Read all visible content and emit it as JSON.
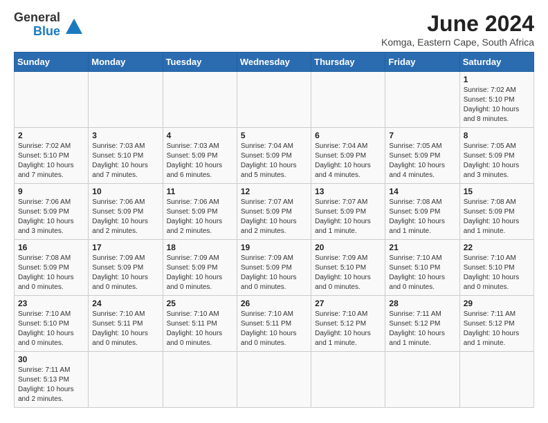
{
  "header": {
    "logo_line1": "General",
    "logo_line2": "Blue",
    "title": "June 2024",
    "location": "Komga, Eastern Cape, South Africa"
  },
  "weekdays": [
    "Sunday",
    "Monday",
    "Tuesday",
    "Wednesday",
    "Thursday",
    "Friday",
    "Saturday"
  ],
  "weeks": [
    [
      {
        "day": "",
        "info": ""
      },
      {
        "day": "",
        "info": ""
      },
      {
        "day": "",
        "info": ""
      },
      {
        "day": "",
        "info": ""
      },
      {
        "day": "",
        "info": ""
      },
      {
        "day": "",
        "info": ""
      },
      {
        "day": "1",
        "info": "Sunrise: 7:02 AM\nSunset: 5:10 PM\nDaylight: 10 hours\nand 8 minutes."
      }
    ],
    [
      {
        "day": "2",
        "info": "Sunrise: 7:02 AM\nSunset: 5:10 PM\nDaylight: 10 hours\nand 7 minutes."
      },
      {
        "day": "3",
        "info": "Sunrise: 7:03 AM\nSunset: 5:10 PM\nDaylight: 10 hours\nand 7 minutes."
      },
      {
        "day": "4",
        "info": "Sunrise: 7:03 AM\nSunset: 5:09 PM\nDaylight: 10 hours\nand 6 minutes."
      },
      {
        "day": "5",
        "info": "Sunrise: 7:04 AM\nSunset: 5:09 PM\nDaylight: 10 hours\nand 5 minutes."
      },
      {
        "day": "6",
        "info": "Sunrise: 7:04 AM\nSunset: 5:09 PM\nDaylight: 10 hours\nand 4 minutes."
      },
      {
        "day": "7",
        "info": "Sunrise: 7:05 AM\nSunset: 5:09 PM\nDaylight: 10 hours\nand 4 minutes."
      },
      {
        "day": "8",
        "info": "Sunrise: 7:05 AM\nSunset: 5:09 PM\nDaylight: 10 hours\nand 3 minutes."
      }
    ],
    [
      {
        "day": "9",
        "info": "Sunrise: 7:06 AM\nSunset: 5:09 PM\nDaylight: 10 hours\nand 3 minutes."
      },
      {
        "day": "10",
        "info": "Sunrise: 7:06 AM\nSunset: 5:09 PM\nDaylight: 10 hours\nand 2 minutes."
      },
      {
        "day": "11",
        "info": "Sunrise: 7:06 AM\nSunset: 5:09 PM\nDaylight: 10 hours\nand 2 minutes."
      },
      {
        "day": "12",
        "info": "Sunrise: 7:07 AM\nSunset: 5:09 PM\nDaylight: 10 hours\nand 2 minutes."
      },
      {
        "day": "13",
        "info": "Sunrise: 7:07 AM\nSunset: 5:09 PM\nDaylight: 10 hours\nand 1 minute."
      },
      {
        "day": "14",
        "info": "Sunrise: 7:08 AM\nSunset: 5:09 PM\nDaylight: 10 hours\nand 1 minute."
      },
      {
        "day": "15",
        "info": "Sunrise: 7:08 AM\nSunset: 5:09 PM\nDaylight: 10 hours\nand 1 minute."
      }
    ],
    [
      {
        "day": "16",
        "info": "Sunrise: 7:08 AM\nSunset: 5:09 PM\nDaylight: 10 hours\nand 0 minutes."
      },
      {
        "day": "17",
        "info": "Sunrise: 7:09 AM\nSunset: 5:09 PM\nDaylight: 10 hours\nand 0 minutes."
      },
      {
        "day": "18",
        "info": "Sunrise: 7:09 AM\nSunset: 5:09 PM\nDaylight: 10 hours\nand 0 minutes."
      },
      {
        "day": "19",
        "info": "Sunrise: 7:09 AM\nSunset: 5:09 PM\nDaylight: 10 hours\nand 0 minutes."
      },
      {
        "day": "20",
        "info": "Sunrise: 7:09 AM\nSunset: 5:10 PM\nDaylight: 10 hours\nand 0 minutes."
      },
      {
        "day": "21",
        "info": "Sunrise: 7:10 AM\nSunset: 5:10 PM\nDaylight: 10 hours\nand 0 minutes."
      },
      {
        "day": "22",
        "info": "Sunrise: 7:10 AM\nSunset: 5:10 PM\nDaylight: 10 hours\nand 0 minutes."
      }
    ],
    [
      {
        "day": "23",
        "info": "Sunrise: 7:10 AM\nSunset: 5:10 PM\nDaylight: 10 hours\nand 0 minutes."
      },
      {
        "day": "24",
        "info": "Sunrise: 7:10 AM\nSunset: 5:11 PM\nDaylight: 10 hours\nand 0 minutes."
      },
      {
        "day": "25",
        "info": "Sunrise: 7:10 AM\nSunset: 5:11 PM\nDaylight: 10 hours\nand 0 minutes."
      },
      {
        "day": "26",
        "info": "Sunrise: 7:10 AM\nSunset: 5:11 PM\nDaylight: 10 hours\nand 0 minutes."
      },
      {
        "day": "27",
        "info": "Sunrise: 7:10 AM\nSunset: 5:12 PM\nDaylight: 10 hours\nand 1 minute."
      },
      {
        "day": "28",
        "info": "Sunrise: 7:11 AM\nSunset: 5:12 PM\nDaylight: 10 hours\nand 1 minute."
      },
      {
        "day": "29",
        "info": "Sunrise: 7:11 AM\nSunset: 5:12 PM\nDaylight: 10 hours\nand 1 minute."
      }
    ],
    [
      {
        "day": "30",
        "info": "Sunrise: 7:11 AM\nSunset: 5:13 PM\nDaylight: 10 hours\nand 2 minutes."
      },
      {
        "day": "",
        "info": ""
      },
      {
        "day": "",
        "info": ""
      },
      {
        "day": "",
        "info": ""
      },
      {
        "day": "",
        "info": ""
      },
      {
        "day": "",
        "info": ""
      },
      {
        "day": "",
        "info": ""
      }
    ]
  ]
}
